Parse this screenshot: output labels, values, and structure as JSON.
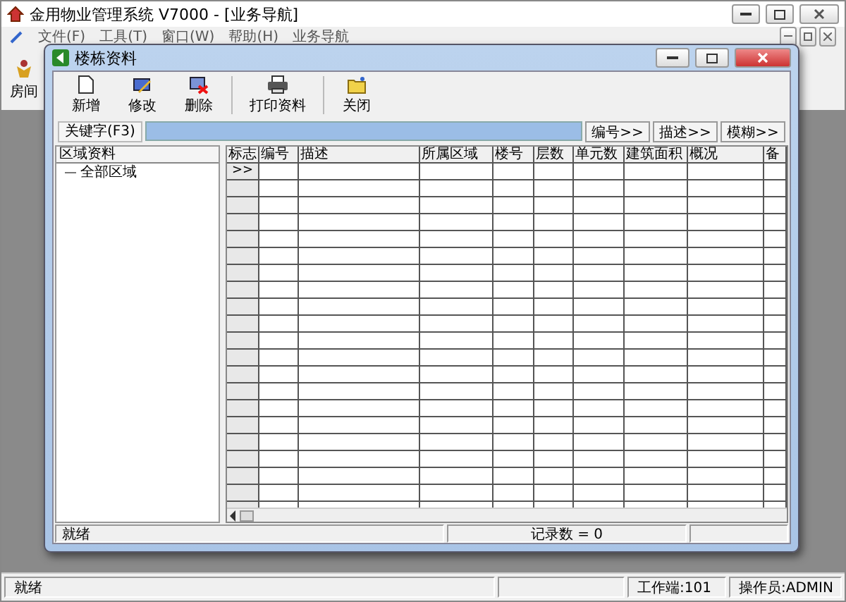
{
  "window": {
    "title": "金用物业管理系统 V7000 - [业务导航]"
  },
  "menu": [
    "文件(F)",
    "工具(T)",
    "窗口(W)",
    "帮助(H)",
    "业务导航"
  ],
  "main_toolbar": [
    {
      "label": "房间"
    }
  ],
  "child_window": {
    "title": "楼栋资料",
    "toolbar": [
      {
        "label": "新增",
        "kind": "new"
      },
      {
        "label": "修改",
        "kind": "edit"
      },
      {
        "label": "删除",
        "kind": "delete"
      },
      {
        "label": "打印资料",
        "kind": "print"
      },
      {
        "label": "关闭",
        "kind": "close"
      }
    ],
    "search_label": "关键字(F3)",
    "search_buttons": [
      "编号>>",
      "描述>>",
      "模糊>>"
    ],
    "tree": {
      "header": "区域资料",
      "items": [
        {
          "label": "全部区域"
        }
      ]
    },
    "table": {
      "columns": [
        "标志",
        "编号",
        "描述",
        "所属区域",
        "楼号",
        "层数",
        "单元数",
        "建筑面积",
        "概况",
        "备"
      ],
      "row_marker": ">>"
    },
    "status_bar": [
      "就绪",
      "记录数 = 0"
    ]
  },
  "status_bar": [
    "就绪",
    "工作端:101",
    "操作员:ADMIN"
  ]
}
